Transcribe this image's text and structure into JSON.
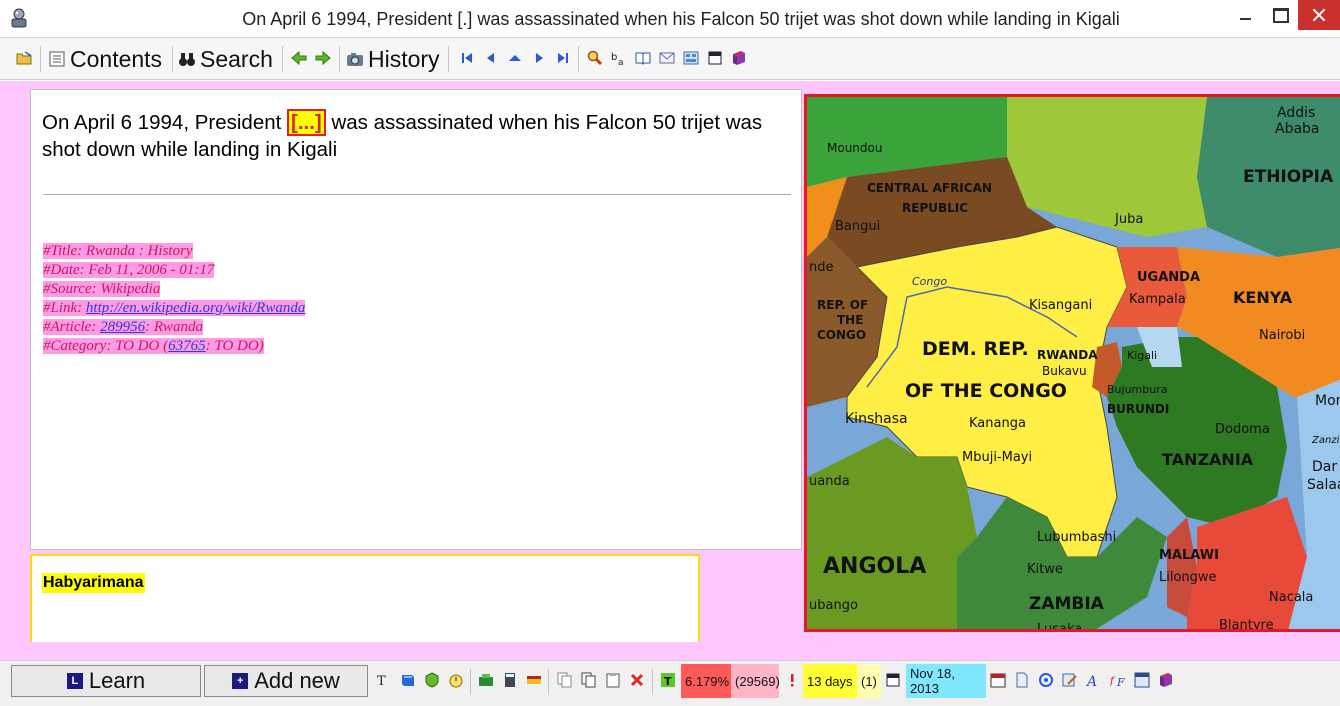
{
  "window": {
    "title": "On April 6 1994, President [.] was assassinated when his Falcon 50 trijet was shot down while landing in Kigali"
  },
  "toolbar": {
    "contents_label": "Contents",
    "search_label": "Search",
    "history_label": "History"
  },
  "question": {
    "before": "On April 6 1994, President ",
    "cloze": "[...]",
    "after": " was assassinated when his Falcon 50 trijet was shot down while landing in Kigali"
  },
  "metadata": {
    "title": "#Title: Rwanda : History",
    "date": "#Date: Feb 11, 2006 - 01:17",
    "source": "#Source: Wikipedia",
    "link_prefix": "#Link: ",
    "link_url": "http://en.wikipedia.org/wiki/Rwanda",
    "article_prefix": "#Article: ",
    "article_id": "289956",
    "article_suffix": ": Rwanda",
    "category_prefix": "#Category: TO DO (",
    "category_id": "63765",
    "category_suffix": ": TO DO)"
  },
  "answer": {
    "text": "Habyarimana"
  },
  "map": {
    "labels": {
      "moundou": "Moundou",
      "car1": "CENTRAL AFRICAN",
      "car2": "REPUBLIC",
      "bangui": "Bangui",
      "addis1": "Addis",
      "addis2": "Ababa",
      "ethiopia": "ETHIOPIA",
      "juba": "Juba",
      "congo_river": "Congo",
      "kisangani": "Kisangani",
      "uganda": "UGANDA",
      "kampala": "Kampala",
      "kenya": "KENYA",
      "nairobi": "Nairobi",
      "rep1": "REP. OF",
      "rep2": "THE",
      "rep3": "CONGO",
      "drc1": "DEM. REP.",
      "drc2": "OF THE CONGO",
      "rwanda": "RWANDA",
      "kigali": "Kigali",
      "bukavu": "Bukavu",
      "bujumbura": "Bujumbura",
      "burundi": "BURUNDI",
      "ende": "nde",
      "kinshasa": "Kinshasa",
      "kananga": "Kananga",
      "mbuji": "Mbuji-Mayi",
      "dodoma": "Dodoma",
      "tanzania": "TANZANIA",
      "mom": "Mom",
      "zanzibar": "Zanzibar",
      "dar1": "Dar es",
      "dar2": "Salaam",
      "luanda": "uanda",
      "lubumbashi": "Lubumbashi",
      "malawi": "MALAWI",
      "lilongwe": "Lilongwe",
      "angola": "ANGOLA",
      "kitwe": "Kitwe",
      "lubango": "ubango",
      "zambia": "ZAMBIA",
      "lusaka": "Lusaka",
      "blantyre": "Blantyre",
      "nacala": "Nacala"
    }
  },
  "bottombar": {
    "learn_label": "Learn",
    "addnew_label": "Add new",
    "pct": "6.179%",
    "count": "(29569)",
    "days": "13 days",
    "pending": "(1)",
    "date": "Nov 18, 2013"
  },
  "colors": {
    "main_bg": "#ffc6ff",
    "cloze_bg": "#ffff00",
    "cloze_fg": "#e02020",
    "meta_fg": "#d4145a",
    "map_border": "#e01a2a"
  }
}
